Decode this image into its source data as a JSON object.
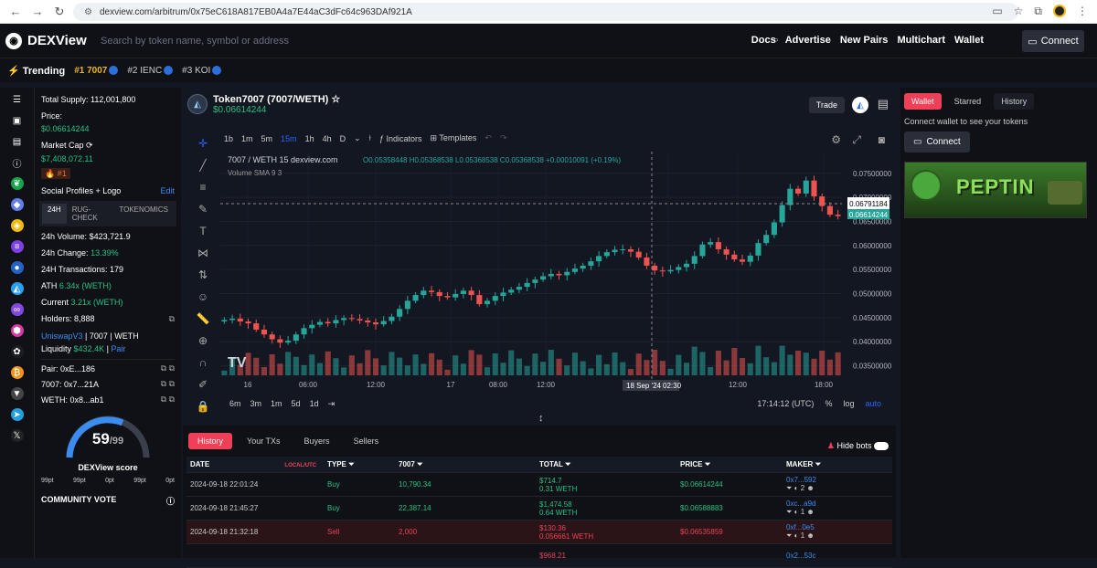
{
  "browser": {
    "url": "dexview.com/arbitrum/0x75eC618A817EB0A4a7E44aC3dFc64c963DAf921A"
  },
  "header": {
    "brand": "DEXView",
    "search_placeholder": "Search by token name, symbol or address",
    "menu": [
      "Docs",
      "Advertise",
      "New Pairs",
      "Multichart",
      "Wallet"
    ],
    "connect": "Connect"
  },
  "trending": {
    "title": "Trending",
    "items": [
      "#1 7007",
      "#2 IENC",
      "#3 KOI"
    ]
  },
  "info": {
    "supply": "Total Supply: 112,001,800",
    "price_label": "Price:",
    "price": "$0.06614244",
    "mcap_label": "Market Cap",
    "mcap": "$7,408,072.11",
    "rank": "#1",
    "social": "Social Profiles + Logo",
    "edit": "Edit",
    "tabs": [
      "24H",
      "RUG-CHECK",
      "TOKENOMICS"
    ],
    "vol_label": "24h Volume:",
    "vol": "$423,721.9",
    "chg_label": "24h Change:",
    "chg": "13.39%",
    "tx": "24H Transactions: 179",
    "ath_label": "ATH",
    "ath": "6.34x (WETH)",
    "cur_label": "Current",
    "cur": "3.21x (WETH)",
    "holders": "Holders: 8,888",
    "dex": "UniswapV3",
    "pairname": "| 7007 | WETH",
    "liq_label": "Liquidity",
    "liq": "$432.4K",
    "pair_link": "Pair",
    "pair": "Pair: 0xE...186",
    "token": "7007: 0x7...21A",
    "weth": "WETH: 0x8...ab1",
    "score": "59",
    "score_max": "/99",
    "score_label": "DEXView score",
    "pts": [
      "99pt",
      "99pt",
      "0pt",
      "99pt",
      "0pt"
    ],
    "community": "COMMUNITY VOTE"
  },
  "chart": {
    "name": "Token7007 (7007/WETH)",
    "price": "$0.06614244",
    "trade": "Trade",
    "intervals": [
      "1b",
      "1m",
      "5m",
      "15m",
      "1h",
      "4h",
      "D"
    ],
    "active_interval": "15m",
    "indicators": "Indicators",
    "templates": "Templates",
    "legend": "7007 / WETH  15  dexview.com",
    "ohlc": "O0.05358448 H0.05368538 L0.05368538 C0.05368538 +0.00010091 (+0.19%)",
    "volume": "Volume SMA 9  3",
    "yticks": [
      "0.07500000",
      "0.07000000",
      "0.06500000",
      "0.06000000",
      "0.05500000",
      "0.05000000",
      "0.04500000",
      "0.04000000",
      "0.03500000"
    ],
    "xticks": [
      "16",
      "06:00",
      "12:00",
      "17",
      "08:00",
      "12:00",
      "06:00",
      "12:00",
      "18:00"
    ],
    "crosshair_date": "18 Sep '24",
    "crosshair_time": "02:30",
    "cross_price": "0.06791184",
    "last_price": "0.06614244",
    "ranges": [
      "6m",
      "3m",
      "1m",
      "5d",
      "1d"
    ],
    "clock": "17:14:12 (UTC)",
    "pct": "%",
    "log": "log",
    "auto": "auto"
  },
  "chart_data": {
    "type": "candlestick",
    "series": [
      {
        "name": "7007 / WETH",
        "values": [
          0.0445,
          0.0448,
          0.0442,
          0.0438,
          0.0425,
          0.0415,
          0.0405,
          0.0398,
          0.0402,
          0.0415,
          0.0428,
          0.0435,
          0.0441,
          0.0438,
          0.0445,
          0.0449,
          0.0447,
          0.0444,
          0.044,
          0.0436,
          0.0443,
          0.0452,
          0.0468,
          0.0485,
          0.0497,
          0.0506,
          0.0503,
          0.0495,
          0.0492,
          0.0499,
          0.0506,
          0.0497,
          0.0478,
          0.0485,
          0.0495,
          0.0502,
          0.0508,
          0.0514,
          0.0522,
          0.0529,
          0.0536,
          0.0541,
          0.0538,
          0.0545,
          0.0552,
          0.0558,
          0.0567,
          0.0578,
          0.0586,
          0.0591,
          0.0592,
          0.0587,
          0.0575,
          0.0558,
          0.0548,
          0.0546,
          0.0549,
          0.0555,
          0.0562,
          0.0578,
          0.0602,
          0.0607,
          0.0592,
          0.0581,
          0.0571,
          0.0566,
          0.0579,
          0.0605,
          0.0622,
          0.0648,
          0.0684,
          0.0718,
          0.0708,
          0.0735,
          0.0702,
          0.0682,
          0.0664,
          0.0661
        ]
      }
    ],
    "ylim": [
      0.033,
      0.078
    ]
  },
  "wallet": {
    "tabs": [
      "Wallet",
      "Starred",
      "History"
    ],
    "msg": "Connect wallet to see your tokens",
    "connect": "Connect",
    "banner": "PEPTIN"
  },
  "history": {
    "tabs": [
      "History",
      "Your TXs",
      "Buyers",
      "Sellers"
    ],
    "hidebots": "Hide bots",
    "cols": [
      "DATE",
      "TYPE",
      "7007",
      "TOTAL",
      "PRICE",
      "MAKER"
    ],
    "tz": "LOCAL/UTC",
    "rows": [
      {
        "date": "2024-09-18 22:01:24",
        "type": "Buy",
        "amt": "10,790.34",
        "total": "$714.7",
        "weth": "0.31 WETH",
        "price": "$0.06614244",
        "maker": "0x7...592",
        "n": "2"
      },
      {
        "date": "2024-09-18 21:45:27",
        "type": "Buy",
        "amt": "22,387.14",
        "total": "$1,474.58",
        "weth": "0.64 WETH",
        "price": "$0.06588883",
        "maker": "0xc...a9d",
        "n": "1"
      },
      {
        "date": "2024-09-18 21:32:18",
        "type": "Sell",
        "amt": "2,000",
        "total": "$130.36",
        "weth": "0.056661 WETH",
        "price": "$0.06535859",
        "maker": "0xf...0e5",
        "n": "1"
      },
      {
        "date": "",
        "type": "",
        "amt": "",
        "total": "$968.21",
        "weth": "",
        "price": "",
        "maker": "0x2...53c",
        "n": ""
      }
    ]
  }
}
